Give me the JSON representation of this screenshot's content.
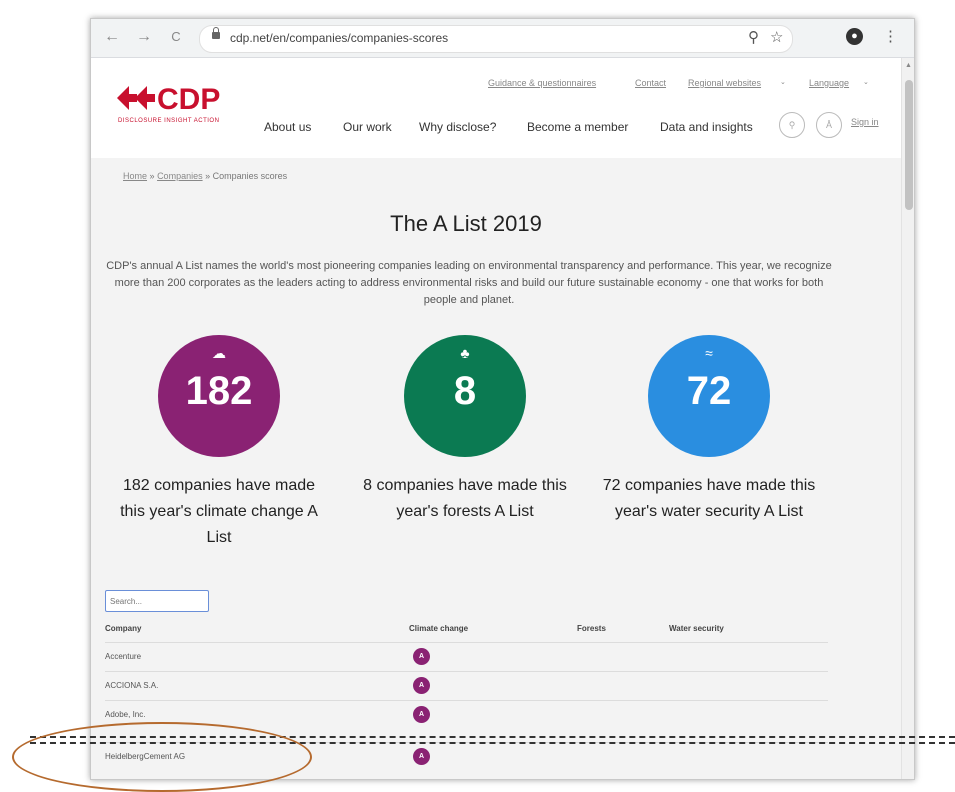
{
  "browser": {
    "url": "cdp.net/en/companies/companies-scores",
    "back_icon": "←",
    "forward_icon": "→",
    "reload_icon": "C",
    "zoom_icon": "⚲",
    "star_icon": "☆",
    "menu_icon": "⋮",
    "profile_letter": "●"
  },
  "header": {
    "logo_text": "CDP",
    "logo_tagline": "DISCLOSURE INSIGHT ACTION",
    "util_nav": [
      "Guidance & questionnaires",
      "Contact",
      "Regional websites",
      "Language"
    ],
    "main_nav": [
      "About us",
      "Our work",
      "Why disclose?",
      "Become a member",
      "Data and insights"
    ],
    "signin": "Sign in"
  },
  "breadcrumb": {
    "home": "Home",
    "sep1": "»",
    "companies": "Companies",
    "sep2": "»",
    "current": "Companies scores"
  },
  "main": {
    "title": "The A List 2019",
    "intro": "CDP's annual A List names the world's most pioneering companies leading on environmental transparency and performance. This year, we recognize more than 200 corporates as the leaders acting to address environmental risks and build our future sustainable economy - one that works for both people and planet.",
    "stats": [
      {
        "number": "182",
        "caption": "182 companies have made this year's climate change A List",
        "color": "#8a2273"
      },
      {
        "number": "8",
        "caption": "8 companies have made this year's forests A List",
        "color": "#0b7a52"
      },
      {
        "number": "72",
        "caption": "72 companies have made this year's water security A List",
        "color": "#2a8ee0"
      }
    ]
  },
  "table": {
    "search_placeholder": "Search...",
    "headers": [
      "Company",
      "Climate change",
      "Forests",
      "Water security"
    ],
    "rows": [
      {
        "company": "Accenture",
        "climate": "A"
      },
      {
        "company": "ACCIONA S.A.",
        "climate": "A"
      },
      {
        "company": "Adobe, Inc.",
        "climate": "A"
      },
      {
        "company": "HeidelbergCement AG",
        "climate": "A"
      }
    ]
  }
}
